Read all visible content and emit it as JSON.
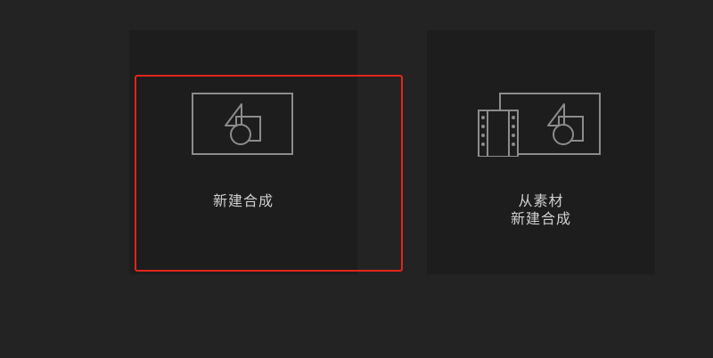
{
  "cards": {
    "new_composition": {
      "label": "新建合成",
      "icon": "composition-icon",
      "selected": true
    },
    "from_footage": {
      "label_line1": "从素材",
      "label_line2": "新建合成",
      "icon": "footage-composition-icon"
    }
  },
  "colors": {
    "background": "#232323",
    "card": "#1d1d1d",
    "selection": "#e1251b",
    "icon_stroke": "#8c8c8c",
    "text": "#cfcfcf"
  }
}
